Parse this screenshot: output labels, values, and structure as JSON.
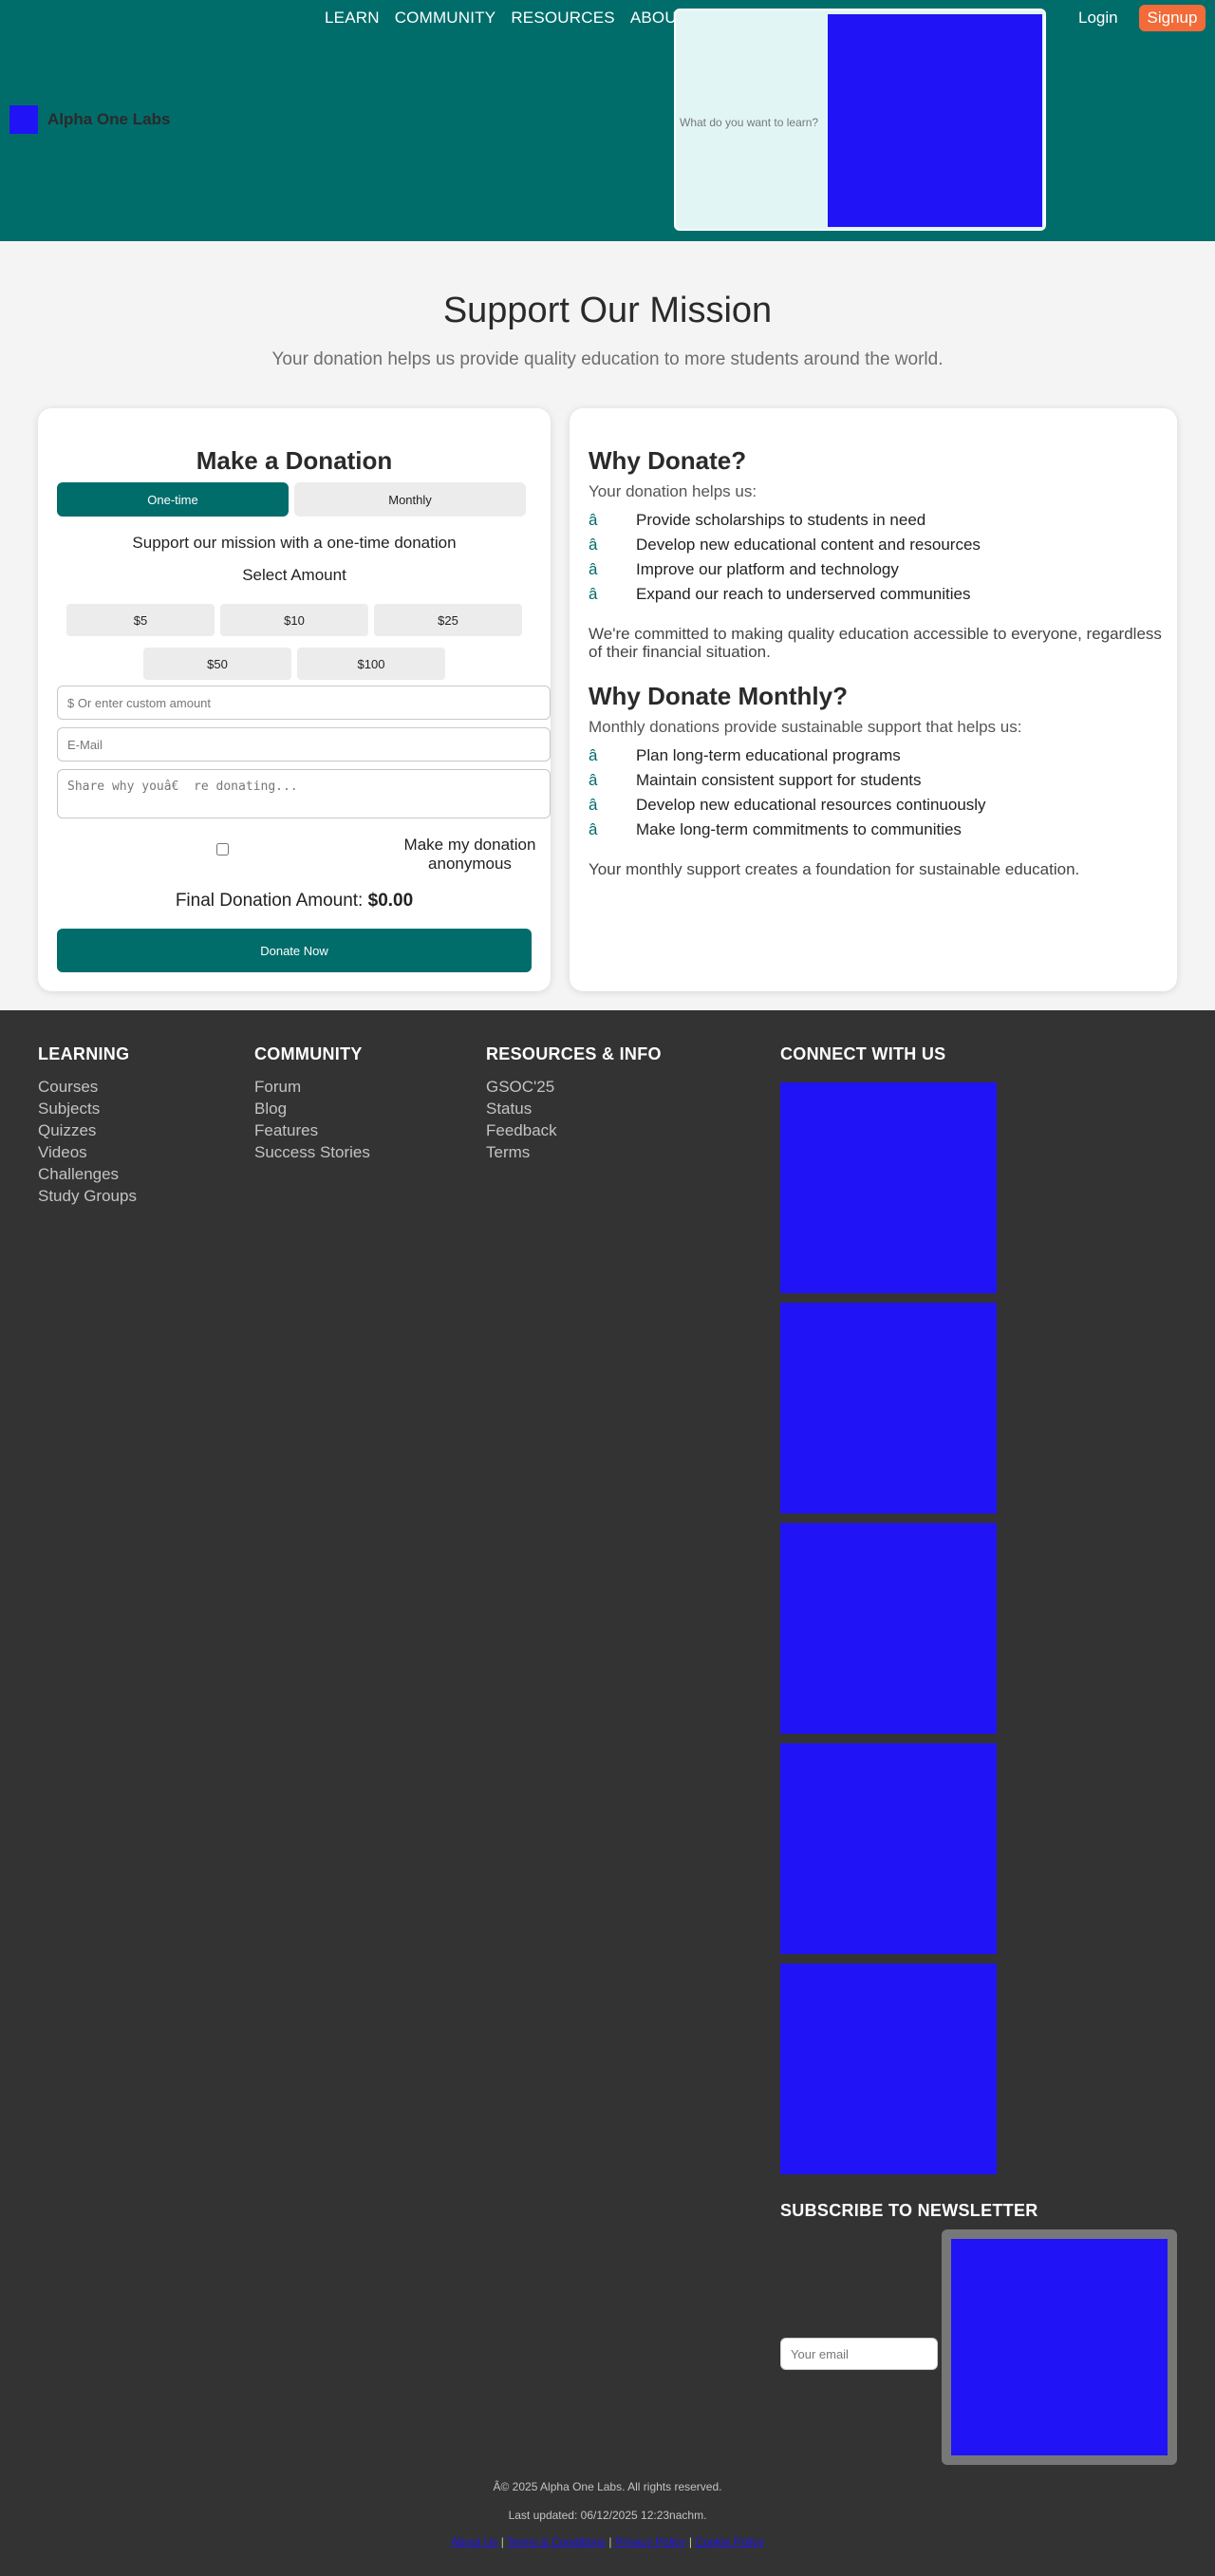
{
  "header": {
    "brand": "Alpha One Labs",
    "nav": [
      "LEARN",
      "COMMUNITY",
      "RESOURCES",
      "ABOUT"
    ],
    "search_placeholder": "What do you want to learn?",
    "login": "Login",
    "signup": "Signup"
  },
  "hero": {
    "title": "Support Our Mission",
    "subtitle": "Your donation helps us provide quality education to more students around the world."
  },
  "donation": {
    "title": "Make a Donation",
    "tab_one_time": "One-time",
    "tab_monthly": "Monthly",
    "mission_text": "Support our mission with a one-time donation",
    "select_amount": "Select Amount",
    "amounts": [
      "$5",
      "$10",
      "$25",
      "$50",
      "$100"
    ],
    "custom_placeholder": "$ Or enter custom amount",
    "email_placeholder": "E-Mail",
    "message_placeholder": "Share why youâ€  re donating...",
    "anonymous_label": "Make my donation anonymous",
    "final_label": "Final Donation Amount:",
    "final_amount": "$0.00",
    "donate_button": "Donate Now"
  },
  "why": {
    "title": "Why Donate?",
    "intro": "Your donation helps us:",
    "bullet": "â",
    "items": [
      "Provide scholarships to students in need",
      "Develop new educational content and resources",
      "Improve our platform and technology",
      "Expand our reach to underserved communities"
    ],
    "closing": "We're committed to making quality education accessible to everyone, regardless of their financial situation."
  },
  "monthly": {
    "title": "Why Donate Monthly?",
    "intro": "Monthly donations provide sustainable support that helps us:",
    "items": [
      "Plan long-term educational programs",
      "Maintain consistent support for students",
      "Develop new educational resources continuously",
      "Make long-term commitments to communities"
    ],
    "closing": "Your monthly support creates a foundation for sustainable education."
  },
  "footer": {
    "learning": {
      "title": "LEARNING",
      "links": [
        "Courses",
        "Subjects",
        "Quizzes",
        "Videos",
        "Challenges",
        "Study Groups"
      ]
    },
    "community": {
      "title": "COMMUNITY",
      "links": [
        "Forum",
        "Blog",
        "Features",
        "Success Stories"
      ]
    },
    "resources": {
      "title": "RESOURCES & INFO",
      "links": [
        "GSOC'25",
        "Status",
        "Feedback",
        "Terms"
      ]
    },
    "connect_title": "CONNECT WITH US",
    "newsletter_title": "SUBSCRIBE TO NEWSLETTER",
    "newsletter_placeholder": "Your email",
    "copyright": "Â© 2025 Alpha One Labs. All rights reserved.",
    "updated": "Last updated: 06/12/2025 12:23nachm.",
    "legal": [
      "About Us",
      "Terms & Conditions",
      "Privacy Policy",
      "Cookie Policy"
    ]
  },
  "colors": {
    "primary": "#006d6b",
    "accent": "#f26b39",
    "placeholder_block": "#2014f6",
    "footer_bg": "#333333"
  }
}
